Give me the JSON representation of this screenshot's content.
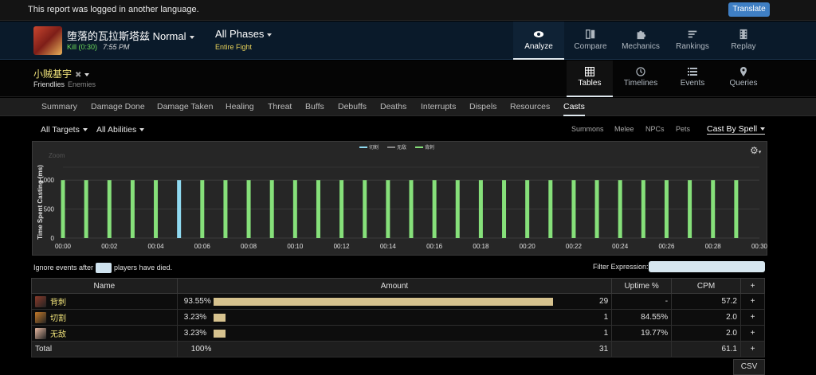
{
  "banner": {
    "message": "This report was logged in another language.",
    "translate_label": "Translate"
  },
  "fight": {
    "boss_name": "堕落的瓦拉斯塔兹 Normal",
    "kill_label": "Kill (0:30)",
    "time": "7:55 PM",
    "phase": "All Phases",
    "phase_sub": "Entire Fight"
  },
  "topnav": [
    {
      "label": "Analyze",
      "icon": "eye-icon",
      "active": true
    },
    {
      "label": "Compare",
      "icon": "compare-icon",
      "active": false
    },
    {
      "label": "Mechanics",
      "icon": "puzzle-icon",
      "active": false
    },
    {
      "label": "Rankings",
      "icon": "rankings-icon",
      "active": false
    },
    {
      "label": "Replay",
      "icon": "film-icon",
      "active": false
    }
  ],
  "player": {
    "name": "小贼基宇",
    "friendlies": "Friendlies",
    "enemies": "Enemies"
  },
  "viewnav": [
    {
      "label": "Tables",
      "icon": "grid-icon",
      "active": true
    },
    {
      "label": "Timelines",
      "icon": "clock-icon",
      "active": false
    },
    {
      "label": "Events",
      "icon": "list-icon",
      "active": false
    },
    {
      "label": "Queries",
      "icon": "pin-icon",
      "active": false
    }
  ],
  "tabs": [
    "Summary",
    "Damage Done",
    "Damage Taken",
    "Healing",
    "Threat",
    "Buffs",
    "Debuffs",
    "Deaths",
    "Interrupts",
    "Dispels",
    "Resources",
    "Casts"
  ],
  "active_tab": "Casts",
  "filters": {
    "targets": "All Targets",
    "abilities": "All Abilities"
  },
  "subviews": [
    "Summons",
    "Melee",
    "NPCs",
    "Pets"
  ],
  "cast_by": "Cast By Spell",
  "chart_data": {
    "type": "bar",
    "ylabel": "Time Spent Casting (ms)",
    "zoom_label": "Zoom",
    "legend": [
      {
        "name": "切割",
        "color": "#8fd9f0"
      },
      {
        "name": "无敌",
        "color": "#888888"
      },
      {
        "name": "背刺",
        "color": "#86e07a"
      }
    ],
    "yticks": [
      "0",
      "500",
      "1,000"
    ],
    "ylim": [
      0,
      1250
    ],
    "xlim": [
      0,
      30
    ],
    "xticks": [
      "00:00",
      "00:02",
      "00:04",
      "00:06",
      "00:08",
      "00:10",
      "00:12",
      "00:14",
      "00:16",
      "00:18",
      "00:20",
      "00:22",
      "00:24",
      "00:26",
      "00:28",
      "00:30"
    ],
    "series": [
      {
        "name": "背刺",
        "color": "#86e07a",
        "x": [
          0,
          1,
          2,
          3,
          4,
          6,
          7,
          8,
          9,
          10,
          11,
          12,
          13,
          14,
          15,
          16,
          17,
          18,
          19,
          20,
          21,
          22,
          23,
          24,
          25,
          26,
          27,
          28,
          29
        ],
        "values": [
          1000,
          1000,
          1000,
          1000,
          1000,
          1000,
          1000,
          1000,
          1000,
          1000,
          1000,
          1000,
          1000,
          1000,
          1000,
          1000,
          1000,
          1000,
          1000,
          1000,
          1000,
          1000,
          1000,
          1000,
          1000,
          1000,
          1000,
          1000,
          1000
        ]
      },
      {
        "name": "切割",
        "color": "#8fd9f0",
        "x": [
          5
        ],
        "values": [
          1000
        ]
      }
    ]
  },
  "ignore": {
    "before": "Ignore events after",
    "after": "players have died."
  },
  "filter_label": "Filter Expression:",
  "table": {
    "headers": {
      "name": "Name",
      "amount": "Amount",
      "uptime": "Uptime %",
      "cpm": "CPM",
      "add": "+"
    },
    "rows": [
      {
        "name": "背刺",
        "icon": "backstab-icon",
        "icon_color": "#8a3a2a",
        "pct": "93.55%",
        "fraction": 0.9355,
        "count": "29",
        "uptime": "-",
        "cpm": "57.2"
      },
      {
        "name": "切割",
        "icon": "slice-icon",
        "icon_color": "#c47a2a",
        "pct": "3.23%",
        "fraction": 0.0323,
        "count": "1",
        "uptime": "84.55%",
        "cpm": "2.0"
      },
      {
        "name": "无敌",
        "icon": "invulnerable-icon",
        "icon_color": "#e6b8a0",
        "pct": "3.23%",
        "fraction": 0.0323,
        "count": "1",
        "uptime": "19.77%",
        "cpm": "2.0"
      }
    ],
    "total": {
      "label": "Total",
      "pct": "100%",
      "count": "31",
      "cpm": "61.1"
    }
  },
  "csv_label": "CSV"
}
